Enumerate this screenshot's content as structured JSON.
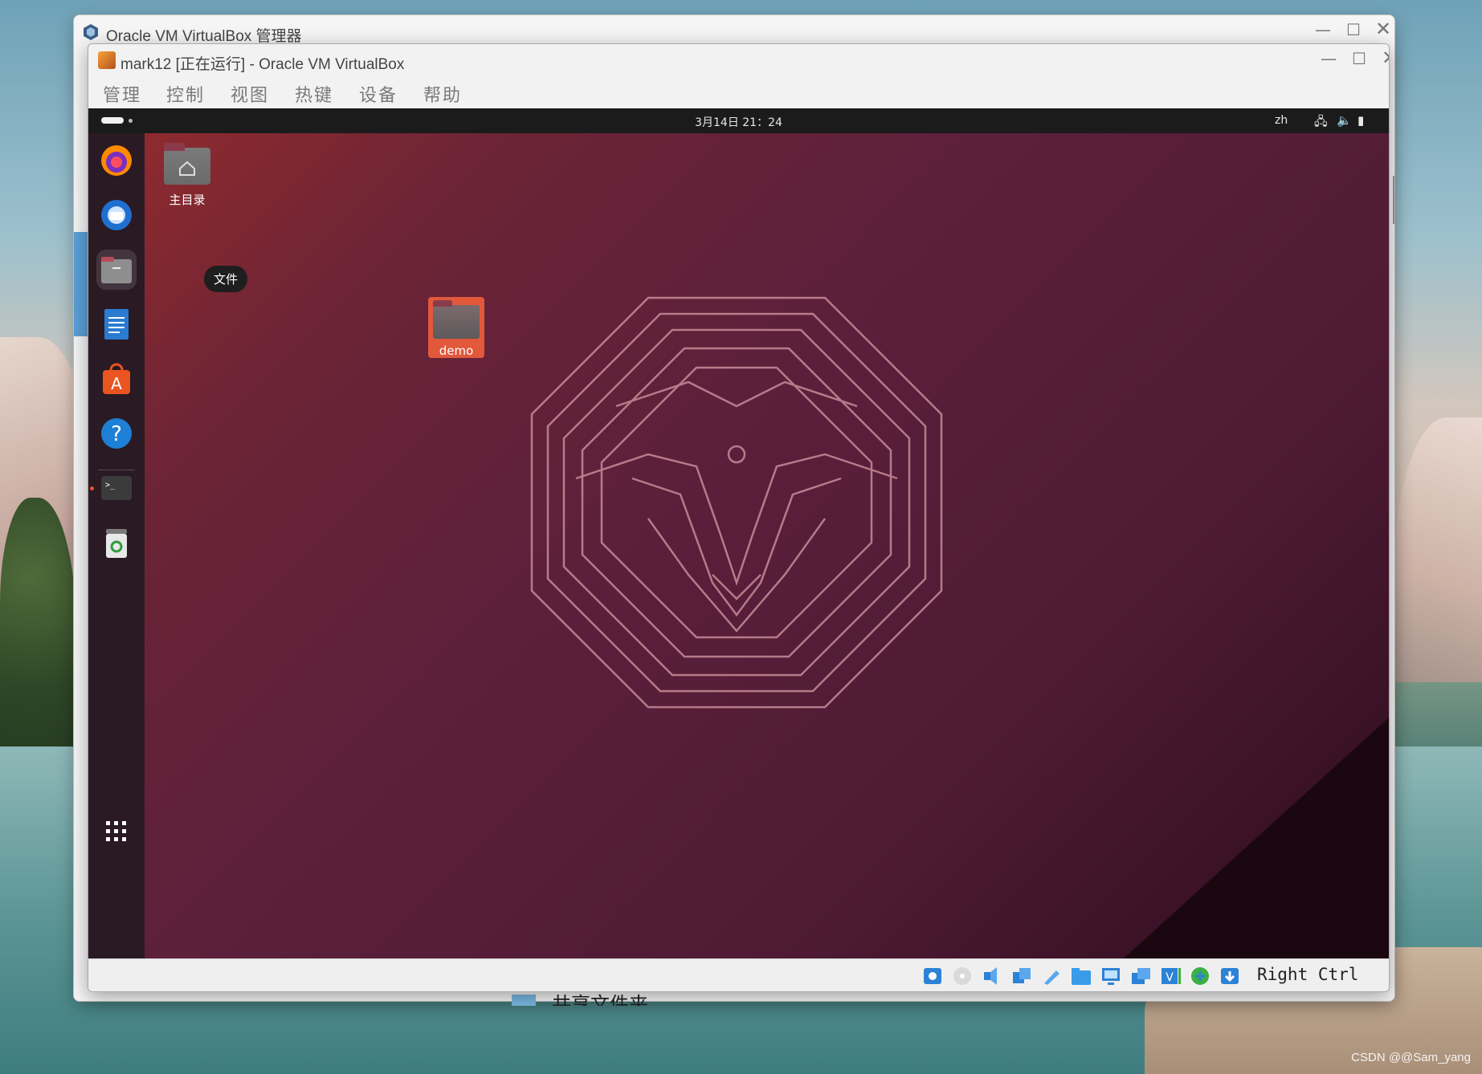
{
  "host": {
    "manager_title": "Oracle VM VirtualBox 管理器",
    "manager_peek_text": "共享文件夹",
    "watermark": "CSDN @@Sam_yang"
  },
  "vm_window": {
    "title": "mark12 [正在运行] - Oracle VM VirtualBox",
    "menu": [
      "管理",
      "控制",
      "视图",
      "热键",
      "设备",
      "帮助"
    ]
  },
  "guest": {
    "clock": "3月14日  21：24",
    "input_lang": "zh",
    "dock": [
      {
        "name": "firefox",
        "icon": "firefox-icon"
      },
      {
        "name": "thunderbird",
        "icon": "thunderbird-icon"
      },
      {
        "name": "files",
        "icon": "files-icon",
        "active": true
      },
      {
        "name": "libreoffice-writer",
        "icon": "writer-icon"
      },
      {
        "name": "ubuntu-software",
        "icon": "software-icon"
      },
      {
        "name": "help",
        "icon": "help-icon"
      },
      {
        "name": "terminal",
        "icon": "terminal-icon",
        "running": true
      },
      {
        "name": "trash",
        "icon": "trash-icon"
      }
    ],
    "tooltip": "文件",
    "desktop_icons": {
      "home_label": "主目录",
      "demo_label": "demo"
    }
  },
  "statusbar": {
    "host_key": "Right Ctrl",
    "icons": [
      "hard-disk-icon",
      "optical-disk-icon",
      "audio-icon",
      "network-icon",
      "usb-icon",
      "shared-folders-icon",
      "display-icon",
      "screen-capture-icon",
      "video-capture-icon",
      "guest-additions-icon",
      "mouse-integration-icon"
    ]
  },
  "colors": {
    "ubuntu_orange": "#e95420",
    "desktop_red": "#8e2a2e",
    "desktop_purple": "#4f1b34"
  }
}
